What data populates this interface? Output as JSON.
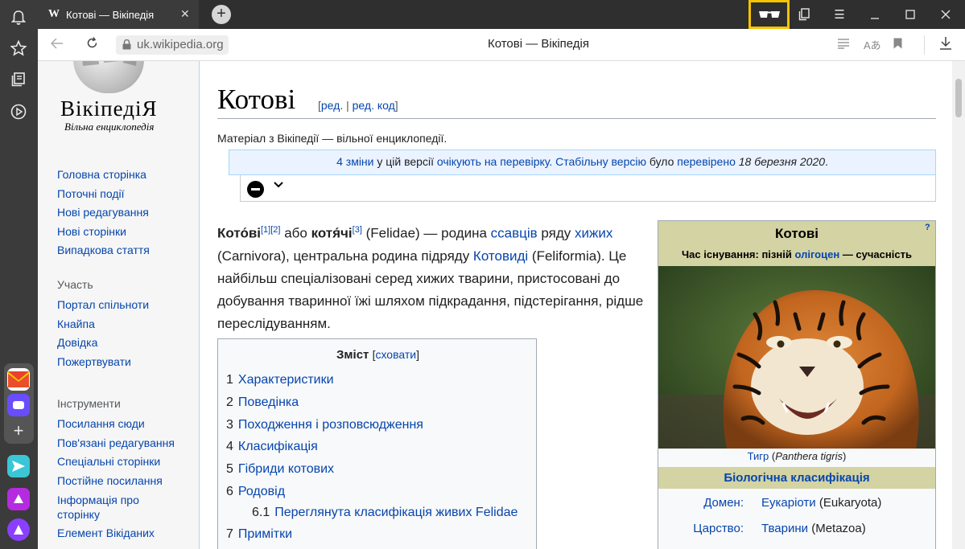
{
  "browser": {
    "tab_title": "Котові — Вікіпедія",
    "tab_favicon": "W",
    "url_host": "uk.wikipedia.org",
    "page_title": "Котові — Вікіпедія",
    "highlight_color": "#f5c400"
  },
  "sidebar_left": {
    "icons": [
      "bell-icon",
      "star-icon",
      "collections-icon",
      "play-icon",
      "mail-icon",
      "messenger-icon",
      "add-icon",
      "send-icon",
      "music-icon",
      "alice-icon"
    ]
  },
  "wiki": {
    "logo_title": "ВікіпедіЯ",
    "logo_subtitle": "Вільна енциклопедія",
    "nav": [
      "Головна сторінка",
      "Поточні події",
      "Нові редагування",
      "Нові сторінки",
      "Випадкова стаття"
    ],
    "participation_header": "Участь",
    "participation": [
      "Портал спільноти",
      "Кнайпа",
      "Довідка",
      "Пожертвувати"
    ],
    "tools_header": "Інструменти",
    "tools": [
      "Посилання сюди",
      "Пов'язані редагування",
      "Спеціальні сторінки",
      "Постійне посилання",
      "Інформація про сторінку",
      "Елемент Вікіданих"
    ]
  },
  "article": {
    "title": "Котові",
    "edit_open": "[",
    "edit": "ред.",
    "edit_sep": "|",
    "edit_code": "ред. код",
    "edit_close": "]",
    "tagline": "Матеріал з Вікіпедії — вільної енциклопедії.",
    "review": {
      "changes": "4 зміни",
      "t1": " у цій версії ",
      "pending": "очікують на перевірку.",
      "stable": "Стабільну версію",
      "t2": " було ",
      "checked": "перевірено",
      "date": " 18 березня 2020",
      "dot": "."
    },
    "intro": {
      "w1": "Кото́ві",
      "ref1": "[1]",
      "ref2": "[2]",
      "t1": " або ",
      "w2": "котя́чі",
      "ref3": "[3]",
      "t2": " (Felidae) — родина ",
      "l1": "ссавців",
      "t3": " ряду ",
      "l2": "хижих",
      "t4": " (Carnivora), центральна родина підряду ",
      "l3": "Котовиді",
      "t5": " (Feliformia). Це найбільш спеціалізовані серед хижих тварини, пристосовані до добування тваринної їжі шляхом підкрадання, підстерігання, рідше переслідуванням."
    },
    "toc": {
      "title": "Зміст",
      "hide_open": "[",
      "hide": "сховати",
      "hide_close": "]",
      "items": [
        {
          "num": "1",
          "label": "Характеристики"
        },
        {
          "num": "2",
          "label": "Поведінка"
        },
        {
          "num": "3",
          "label": "Походження і розповсюдження"
        },
        {
          "num": "4",
          "label": "Класифікація"
        },
        {
          "num": "5",
          "label": "Гібриди котових"
        },
        {
          "num": "6",
          "label": "Родовід"
        },
        {
          "num": "6.1",
          "label": "Переглянута класифікація живих Felidae"
        },
        {
          "num": "7",
          "label": "Примітки"
        }
      ]
    },
    "infobox": {
      "title": "Котові",
      "q": "?",
      "sub1": "Час існування: пізній ",
      "sub_link": "олігоцен",
      "sub2": " — сучасність",
      "caption_link": "Тигр",
      "caption_open": " (",
      "caption_species": "Panthera tigris",
      "caption_close": ")",
      "class_header": "Біологічна класифікація",
      "rows": [
        {
          "key": "Домен:",
          "link": "Еукаріоти",
          "rest": " (Eukaryota)"
        },
        {
          "key": "Царство:",
          "link": "Тварини",
          "rest": " (Metazoa)"
        }
      ]
    }
  }
}
